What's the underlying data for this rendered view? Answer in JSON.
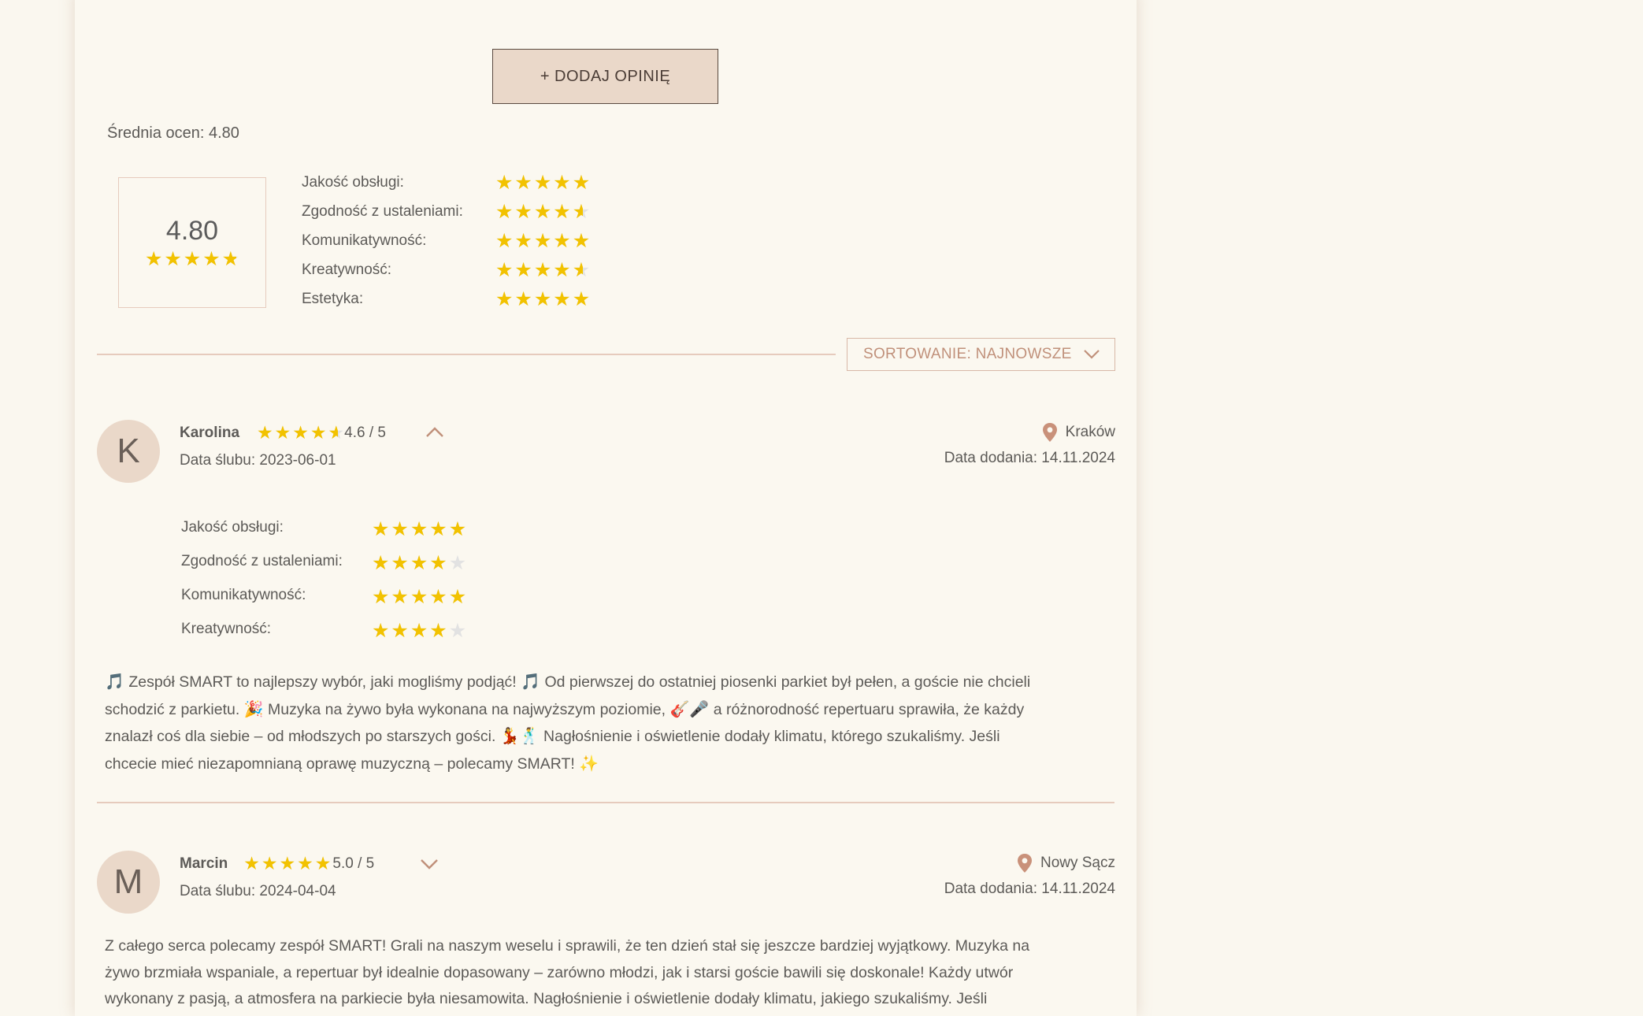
{
  "add_review_label": "+ DODAJ OPINIĘ",
  "average_label": "Średnia ocen: 4.80",
  "average_value": "4.80",
  "average_rating": 4.8,
  "criteria": [
    {
      "label": "Jakość obsługi:",
      "rating": 5
    },
    {
      "label": "Zgodność z ustaleniami:",
      "rating": 4.6
    },
    {
      "label": "Komunikatywność:",
      "rating": 5
    },
    {
      "label": "Kreatywność:",
      "rating": 4.6
    },
    {
      "label": "Estetyka:",
      "rating": 5
    }
  ],
  "sort_label": "SORTOWANIE: NAJNOWSZE",
  "reviews": [
    {
      "initial": "K",
      "name": "Karolina",
      "rating": 4.6,
      "rating_text": "4.6 / 5",
      "wedding_date": "Data ślubu: 2023-06-01",
      "location": "Kraków",
      "added": "Data dodania: 14.11.2024",
      "expanded": true,
      "criteria": [
        {
          "label": "Jakość obsługi:",
          "rating": 5
        },
        {
          "label": "Zgodność z ustaleniami:",
          "rating": 4
        },
        {
          "label": "Komunikatywność:",
          "rating": 5
        },
        {
          "label": "Kreatywność:",
          "rating": 4
        }
      ],
      "text_lines": [
        [
          "🎵",
          " Zespół SMART to najlepszy wybór, jaki mogliśmy podjąć! ",
          "🎵",
          " Od pierwszej do ostatniej piosenki parkiet był pełen, a goście nie chcieli"
        ],
        [
          "schodzić z parkietu. ",
          "🎉",
          " Muzyka na żywo była wykonana na najwyższym poziomie, ",
          "🎸🎤",
          " a różnorodność repertuaru sprawiła, że każdy"
        ],
        [
          "znalazł coś dla siebie – od młodszych po starszych gości. ",
          "💃🕺",
          " Nagłośnienie i oświetlenie dodały klimatu, którego szukaliśmy. Jeśli"
        ],
        [
          "chcecie mieć niezapomnianą oprawę muzyczną – polecamy SMART! ",
          "✨"
        ]
      ]
    },
    {
      "initial": "M",
      "name": "Marcin",
      "rating": 5,
      "rating_text": "5.0 / 5",
      "wedding_date": "Data ślubu: 2024-04-04",
      "location": "Nowy Sącz",
      "added": "Data dodania: 14.11.2024",
      "expanded": false,
      "text_lines": [
        [
          "Z całego serca polecamy zespół SMART! Grali na naszym weselu i sprawili, że ten dzień stał się jeszcze bardziej wyjątkowy. Muzyka na"
        ],
        [
          "żywo brzmiała wspaniale, a repertuar był idealnie dopasowany – zarówno młodzi, jak i starsi goście bawili się doskonale! Każdy utwór"
        ],
        [
          "wykonany z pasją, a atmosfera na parkiecie była niesamowita. Nagłośnienie i oświetlenie dodały klimatu, jakiego szukaliśmy. Jeśli"
        ]
      ]
    }
  ],
  "colors": {
    "star": "#f2c200",
    "star_empty": "#e2e2e2",
    "accent": "#c0907a",
    "button_bg": "#ead8c9"
  }
}
